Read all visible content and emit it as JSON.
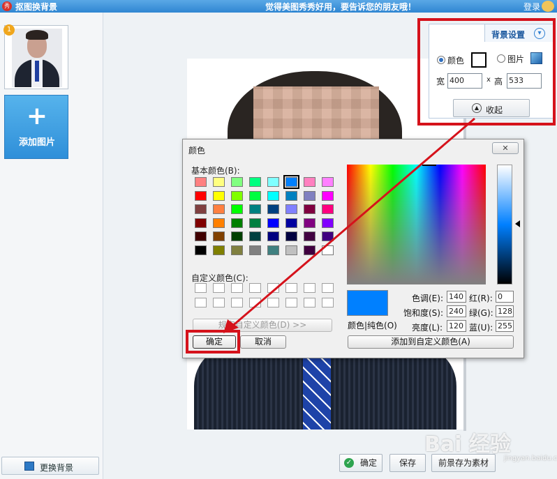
{
  "titlebar": {
    "logo": "秀",
    "title": "抠图换背景",
    "slogan": "觉得美图秀秀好用，要告诉您的朋友哦！",
    "login": "登录"
  },
  "sidebar": {
    "thumb_badge": "1",
    "add_label": "添加图片",
    "add_icon": "+",
    "change_bg_label": "更换背景"
  },
  "panel": {
    "tab_label": "背景设置",
    "color_label": "颜色",
    "image_label": "图片",
    "width_label": "宽",
    "width_value": "400",
    "height_label": "高",
    "height_value": "533",
    "times": "x",
    "collapse_label": "收起",
    "selected_mode": "颜色"
  },
  "dialog": {
    "title": "颜色",
    "basic_colors_label": "基本颜色(B):",
    "custom_colors_label": "自定义颜色(C):",
    "define_custom_label": "规定自定义颜色(D) >>",
    "ok_label": "确定",
    "cancel_label": "取消",
    "add_custom_label": "添加到自定义颜色(A)",
    "color_solid_label": "颜色|纯色(O)",
    "hue_label": "色调(E):",
    "hue": "140",
    "sat_label": "饱和度(S):",
    "sat": "240",
    "lum_label": "亮度(L):",
    "lum": "120",
    "red_label": "红(R):",
    "red": "0",
    "green_label": "绿(G):",
    "green": "128",
    "blue_label": "蓝(U):",
    "blue": "255",
    "current_color": "#0080ff",
    "basic_colors": [
      "#ff8080",
      "#ffff80",
      "#80ff80",
      "#00ff80",
      "#80ffff",
      "#0080ff",
      "#ff80c0",
      "#ff80ff",
      "#ff0000",
      "#ffff00",
      "#80ff00",
      "#00ff40",
      "#00ffff",
      "#0080c0",
      "#8080c0",
      "#ff00ff",
      "#804040",
      "#ff8040",
      "#00ff00",
      "#008080",
      "#004080",
      "#8080ff",
      "#800040",
      "#ff0080",
      "#800000",
      "#ff8000",
      "#008000",
      "#008040",
      "#0000ff",
      "#0000a0",
      "#800080",
      "#8000ff",
      "#400000",
      "#804000",
      "#004000",
      "#004040",
      "#000080",
      "#000040",
      "#400040",
      "#400080",
      "#000000",
      "#808000",
      "#808040",
      "#808080",
      "#408080",
      "#c0c0c0",
      "#400040",
      "#ffffff"
    ],
    "selected_basic_index": 5
  },
  "bottom": {
    "ok_label": "确定",
    "save_label": "保存",
    "save_as_label": "前景存为素材"
  },
  "watermark": {
    "brand": "Bai 经验",
    "url": "jingyan.baidu.com"
  }
}
